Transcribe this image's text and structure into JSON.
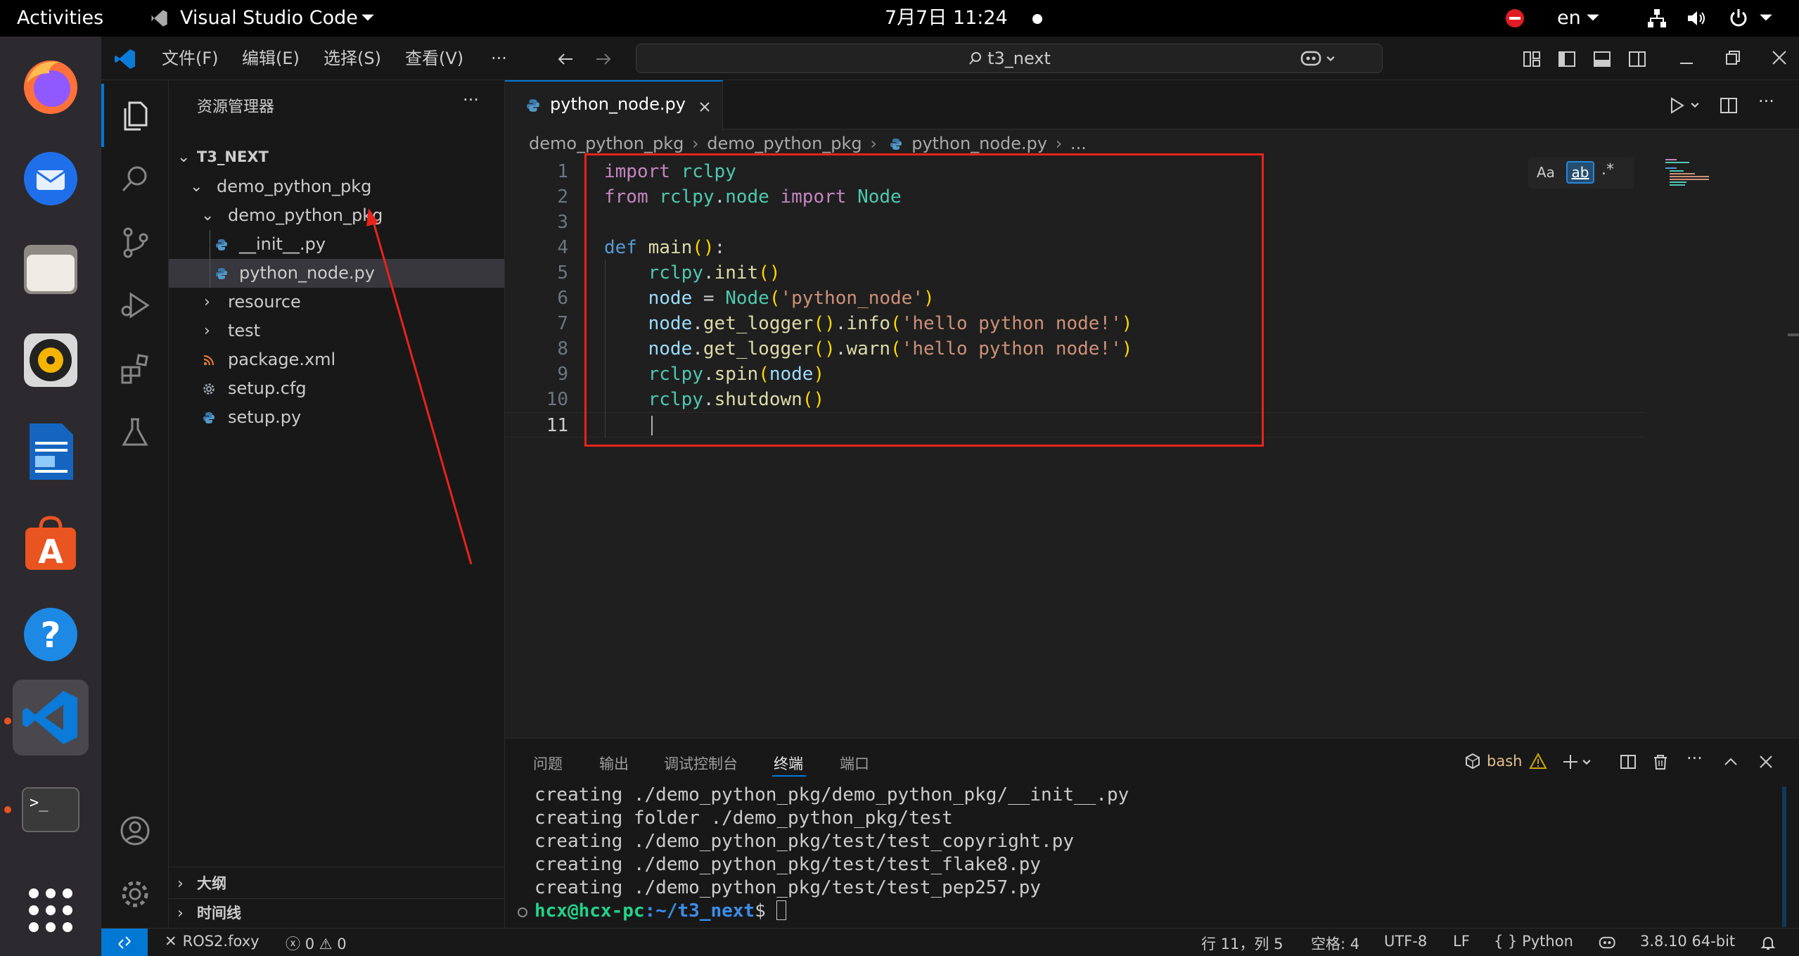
{
  "topbar": {
    "activities": "Activities",
    "app_name": "Visual Studio Code",
    "clock": "7月7日  11:24",
    "lang": "en"
  },
  "dock": {
    "items": [
      "firefox",
      "thunderbird",
      "files",
      "rhythmbox",
      "writer",
      "app-center",
      "help",
      "vscode",
      "terminal",
      "show-apps"
    ]
  },
  "titlebar": {
    "menus": [
      "文件(F)",
      "编辑(E)",
      "选择(S)",
      "查看(V)",
      "···"
    ],
    "search": "t3_next"
  },
  "sidebar": {
    "title": "资源管理器",
    "root": "T3_NEXT",
    "items": [
      {
        "label": "demo_python_pkg",
        "kind": "folder"
      },
      {
        "label": "demo_python_pkg",
        "kind": "folder"
      },
      {
        "label": "__init__.py",
        "kind": "python"
      },
      {
        "label": "python_node.py",
        "kind": "python"
      },
      {
        "label": "resource",
        "kind": "folder"
      },
      {
        "label": "test",
        "kind": "folder"
      },
      {
        "label": "package.xml",
        "kind": "rss"
      },
      {
        "label": "setup.cfg",
        "kind": "gear"
      },
      {
        "label": "setup.py",
        "kind": "python"
      }
    ],
    "outline": "大纲",
    "timeline": "时间线"
  },
  "editor": {
    "tab": "python_node.py",
    "breadcrumb": [
      "demo_python_pkg",
      "demo_python_pkg",
      "python_node.py",
      "..."
    ],
    "find_aa": "Aa",
    "find_ab": "ab",
    "find_re": ".*",
    "lines": [
      "1",
      "2",
      "3",
      "4",
      "5",
      "6",
      "7",
      "8",
      "9",
      "10",
      "11"
    ]
  },
  "panel": {
    "tabs": [
      "问题",
      "输出",
      "调试控制台",
      "终端",
      "端口"
    ],
    "shell": "bash",
    "terminal": [
      "creating ./demo_python_pkg/demo_python_pkg/__init__.py",
      "creating folder ./demo_python_pkg/test",
      "creating ./demo_python_pkg/test/test_copyright.py",
      "creating ./demo_python_pkg/test/test_flake8.py",
      "creating ./demo_python_pkg/test/test_pep257.py"
    ],
    "prompt_user": "hcx@hcx-pc",
    "prompt_path": ":~/t3_next",
    "prompt_sym": "$"
  },
  "statusbar": {
    "ros": "ROS2.foxy",
    "problems": "0",
    "warnings": "0",
    "position": "行 11，列 5",
    "spaces": "空格: 4",
    "encoding": "UTF-8",
    "eol": "LF",
    "language": "Python",
    "interpreter": "3.8.10 64-bit"
  },
  "colors": {
    "accent": "#0078d4",
    "annotation": "#e8231b",
    "terminal_prompt": "#23d18b"
  }
}
